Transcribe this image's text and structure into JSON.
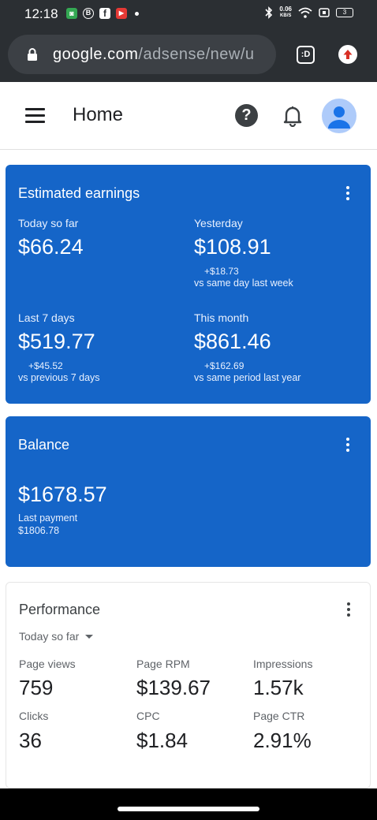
{
  "status_bar": {
    "time": "12:18",
    "notifications": [
      {
        "icon": "messaging-app-icon",
        "glyph": "◙",
        "color": "#34a853"
      },
      {
        "icon": "b-app-icon",
        "glyph": "B",
        "color": "#2b2f33"
      },
      {
        "icon": "facebook-icon",
        "glyph": "f",
        "color": "#2b2f33"
      },
      {
        "icon": "video-app-icon",
        "glyph": "▶",
        "color": "#e53935"
      }
    ],
    "net_speed": "0.06",
    "net_speed_unit": "KB/S",
    "battery": "3"
  },
  "browser": {
    "url_domain": "google.com",
    "url_path": "/adsense/new/u",
    "tabs_label": ":D"
  },
  "header": {
    "title": "Home",
    "help_glyph": "?"
  },
  "estimated_earnings": {
    "title": "Estimated earnings",
    "today": {
      "label": "Today so far",
      "value": "$66.24"
    },
    "yesterday": {
      "label": "Yesterday",
      "value": "$108.91",
      "delta": "+$18.73",
      "compare": "vs same day last week"
    },
    "last7": {
      "label": "Last 7 days",
      "value": "$519.77",
      "delta": "+$45.52",
      "compare": "vs previous 7 days"
    },
    "month": {
      "label": "This month",
      "value": "$861.46",
      "delta": "+$162.69",
      "compare": "vs same period last year"
    }
  },
  "balance": {
    "title": "Balance",
    "value": "$1678.57",
    "last_payment_label": "Last payment",
    "last_payment_value": "$1806.78"
  },
  "performance": {
    "title": "Performance",
    "range": "Today so far",
    "metrics": [
      {
        "label": "Page views",
        "value": "759"
      },
      {
        "label": "Page RPM",
        "value": "$139.67"
      },
      {
        "label": "Impressions",
        "value": "1.57k"
      },
      {
        "label": "Clicks",
        "value": "36"
      },
      {
        "label": "CPC",
        "value": "$1.84"
      },
      {
        "label": "Page CTR",
        "value": "2.91%"
      }
    ]
  },
  "colors": {
    "card_blue": "#1565c8",
    "status_bar": "#2b2f33",
    "text_dark": "#202124"
  }
}
